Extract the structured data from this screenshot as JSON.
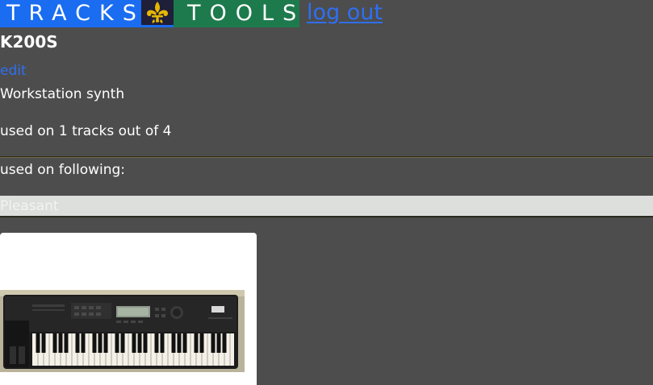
{
  "header": {
    "brand_left": "TRACKS",
    "brand_right": "TOOLS",
    "logo_icon": "fleur-de-lis-icon",
    "logout_label": "log out",
    "colors": {
      "tracks_bg": "#1a6cf0",
      "tools_bg": "#1d7a4c",
      "logo_gold": "#e6b800",
      "link": "#2f6ff2"
    }
  },
  "instrument": {
    "name": "K200S",
    "edit_label": "edit",
    "description": "Workstation synth",
    "usage_text": "used on 1 tracks out of 4"
  },
  "usage_list": {
    "heading": "used on following:",
    "tracks": [
      "Pleasant"
    ]
  },
  "image": {
    "subject": "synthesizer keyboard photo"
  }
}
